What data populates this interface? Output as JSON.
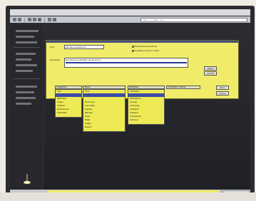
{
  "toolbar": {
    "buttons": [
      "back-icon",
      "forward-icon",
      "stop-icon",
      "reload-icon",
      "home-icon",
      "search-icon",
      "print-icon"
    ],
    "url": "..nc.../..../..../mo......w..."
  },
  "dialog": {
    "name_label": "Nom",
    "name_value": "premier-exemple.htm",
    "radios": [
      {
        "label": "Prendre la forme Pré-ta",
        "checked": true
      },
      {
        "label": "Combiner la forme entrée",
        "checked": false
      }
    ],
    "comment_label": "Remarque",
    "comment_value": "Exemple de vérification du document",
    "ok_label": "Valider",
    "cancel_label": "Annuler",
    "filter_label": "Filtrer",
    "about_label": "Aperçu",
    "columns": [
      {
        "header": "Catégories",
        "items": [
          "Tout",
          "...",
          "Méthodes",
          "Objets",
          "Attributs",
          "Événements",
          "Propriétés"
        ],
        "selected": 1
      },
      {
        "header": "Objets",
        "items": [
          "Tous",
          "...",
          "...",
          "Document",
          "Formulaire",
          "Fenêtre",
          "Élément",
          "Texte",
          "Table",
          "Image",
          "Bouton"
        ],
        "selected": 1
      },
      {
        "header": "Méthodes",
        "items": [
          "méthode1",
          "...",
          "actionEvent",
          "onLoad",
          "onChange",
          "onSubmit",
          "onSelect",
          "onKeyDown",
          "onFocus"
        ],
        "selected": 1
      },
      {
        "header": "Propriétés / attribut",
        "items": [],
        "selected": -1
      }
    ]
  },
  "status": {
    "right_text": "fin"
  },
  "colors": {
    "dialog_bg": "#f0ec6a",
    "selection": "#3b4ba7",
    "sidebar": "#27272c"
  }
}
